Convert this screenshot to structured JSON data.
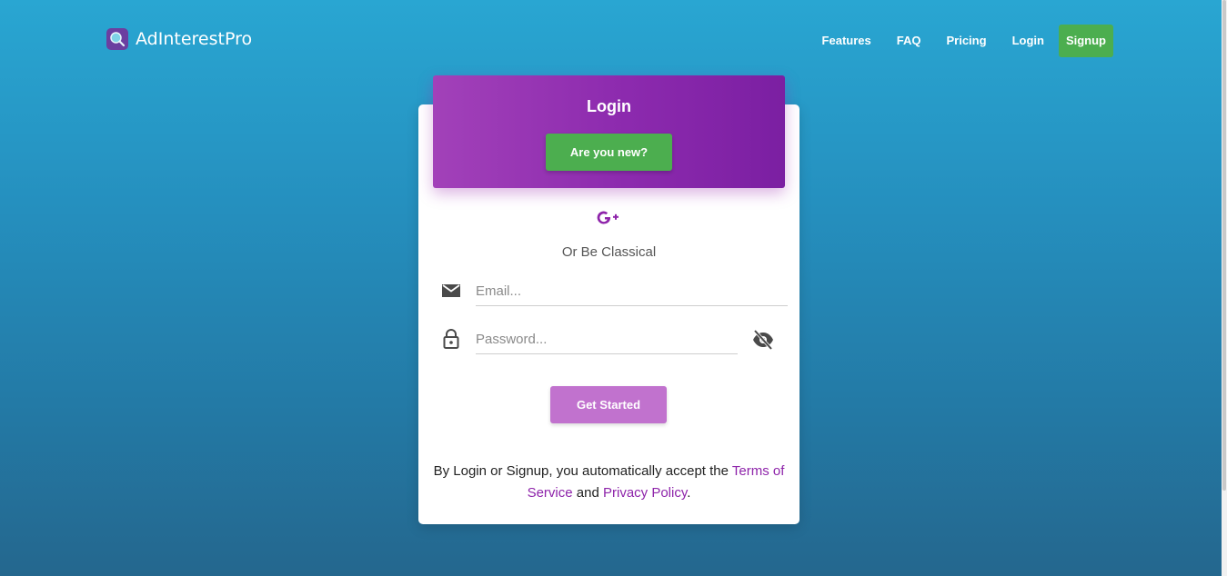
{
  "brand": {
    "name": "AdInterestPro",
    "logo_icon": "magnifier-logo-icon"
  },
  "nav": {
    "features": "Features",
    "faq": "FAQ",
    "pricing": "Pricing",
    "login": "Login",
    "signup": "Signup"
  },
  "card": {
    "title": "Login",
    "new_button": "Are you new?",
    "social_icon": "google-plus-icon",
    "classical_text": "Or Be Classical",
    "email": {
      "placeholder": "Email...",
      "value": ""
    },
    "password": {
      "placeholder": "Password...",
      "value": ""
    },
    "submit": "Get Started",
    "terms": {
      "prefix": "By Login or Signup, you automatically accept the ",
      "tos": "Terms of Service",
      "middle": " and ",
      "privacy": "Privacy Policy",
      "suffix": "."
    }
  },
  "colors": {
    "accent_purple": "#9c27b0",
    "signup_green": "#4cae4f",
    "submit_purple": "#c172ce"
  }
}
